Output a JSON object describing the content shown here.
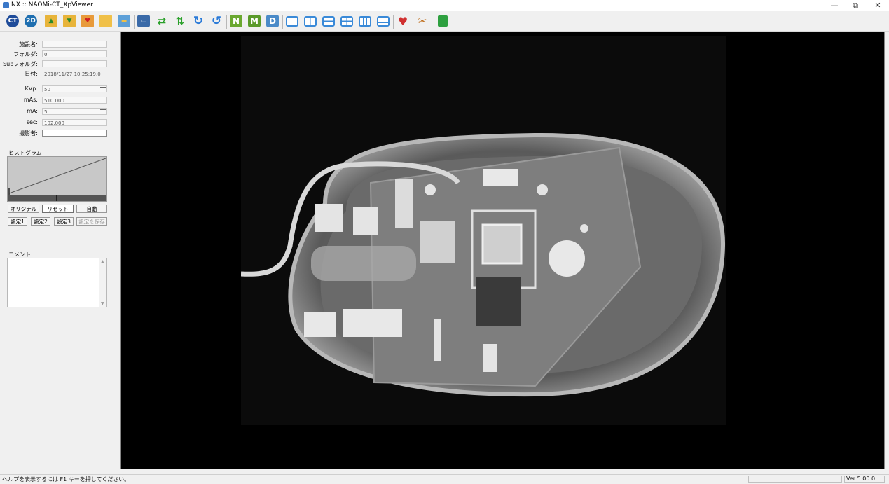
{
  "window": {
    "title": "NX :: NAOMi-CT_XpViewer",
    "min_glyph": "—",
    "max_glyph": "⧉",
    "close_glyph": "✕"
  },
  "toolbar": {
    "ct_label": "CT",
    "twod_label": "2D",
    "icons": [
      "ct-icon",
      "2d-icon",
      "folder-up-icon",
      "folder-down-icon",
      "folder-heart-icon",
      "folder-open-icon",
      "folder-stack-icon",
      "monitor-icon",
      "rotate-swap-icon",
      "flip-icon",
      "redo-icon",
      "undo-icon",
      "n-tool-icon",
      "m-tool-icon",
      "d-tool-icon",
      "layout-single-icon",
      "layout-split-vertical-icon",
      "layout-split-horizontal-icon",
      "layout-quad-icon",
      "layout-grid-icon",
      "layout-list-icon",
      "check-heart-icon",
      "tools-icon",
      "lock-icon"
    ],
    "n_label": "N",
    "m_label": "M",
    "d_label": "D"
  },
  "info": {
    "facility_label": "施設名:",
    "facility_value": "",
    "folder_label": "フォルダ:",
    "folder_value": "0",
    "subfolder_label": "Subフォルダ:",
    "subfolder_value": "",
    "date_label": "日付:",
    "date_value": "2018/11/27 10:25:19.0",
    "kvp_label": "KVp:",
    "kvp_value": "50",
    "mas_label": "mAs:",
    "mas_value": "510.000",
    "ma_label": "mA:",
    "ma_value": "5",
    "sec_label": "sec:",
    "sec_value": "102.000",
    "operator_label": "撮影者:",
    "operator_value": ""
  },
  "histogram": {
    "label": "ヒストグラム",
    "original_button": "オリジナル",
    "reset_button": "リセット",
    "auto_button": "自動",
    "preset1_button": "設定1",
    "preset2_button": "設定2",
    "preset3_button": "設定3",
    "save_preset_button": "設定を保存"
  },
  "comment": {
    "label": "コメント:",
    "value": ""
  },
  "status": {
    "help_text": "ヘルプを表示するには F1 キーを押してください。",
    "version": "Ver 5.00.0"
  }
}
